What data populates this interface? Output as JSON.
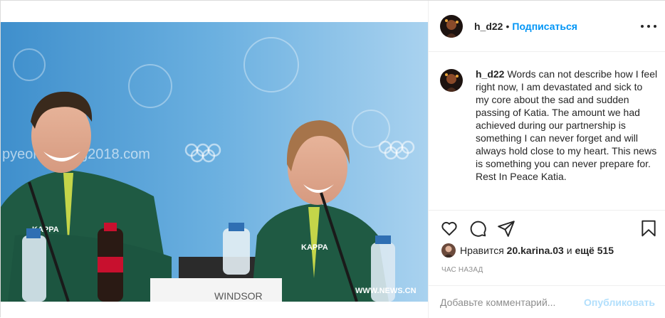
{
  "header": {
    "username": "h_d22",
    "separator": "•",
    "follow_label": "Подписаться"
  },
  "caption": {
    "username": "h_d22",
    "text": "Words can not describe how I feel right now, I am devastated and sick to my core about the sad and sudden passing of Katia. The amount we had achieved during our partnership is something I can never forget and will always hold close to my heart. This news is something you can never prepare for. Rest In Peace Katia."
  },
  "photo": {
    "backdrop_text": "pyeongchang2018.com",
    "watermark": "WWW.NEWS.CN",
    "nameplate": "WINDSOR",
    "jacket_brand": "KAPPA"
  },
  "likes": {
    "prefix": "Нравится",
    "user": "20.karina.03",
    "conj": "и",
    "more": "ещё 515"
  },
  "time_label": "ЧАС НАЗАД",
  "comment": {
    "placeholder": "Добавьте комментарий...",
    "post_label": "Опубликовать"
  },
  "icons": [
    "heart-icon",
    "comment-icon",
    "share-icon",
    "bookmark-icon",
    "more-icon"
  ],
  "colors": {
    "link": "#0095f6",
    "post_disabled": "#b2dffc",
    "muted": "#8e8e8e",
    "jacket": "#1f5a43",
    "backdrop": "#4e9fd8"
  }
}
